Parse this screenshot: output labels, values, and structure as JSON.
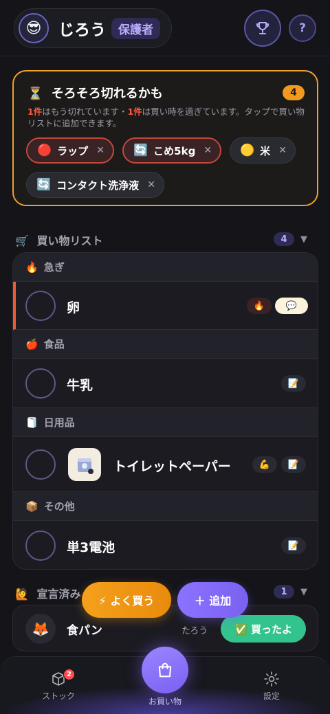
{
  "header": {
    "avatar_emoji": "😎",
    "user_name": "じろう",
    "role": "保護者",
    "help_label": "?"
  },
  "alert": {
    "icon": "⏳",
    "title": "そろそろ切れるかも",
    "count": "4",
    "desc_count1": "1件",
    "desc_part1": "はもう切れています・",
    "desc_count2": "1件",
    "desc_part2": "は買い時を過ぎています。タップで買い物リストに追加できます。",
    "chips": [
      {
        "emoji": "🔴",
        "label": "ラップ",
        "close": "✕",
        "style": "red"
      },
      {
        "emoji": "🔄",
        "label": "こめ5kg",
        "close": "✕",
        "style": "red"
      },
      {
        "emoji": "🟡",
        "label": "米",
        "close": "✕",
        "style": "gray"
      },
      {
        "emoji": "🔄",
        "label": "コンタクト洗浄液",
        "close": "✕",
        "style": "gray"
      }
    ]
  },
  "shopping_list": {
    "icon": "🛒",
    "title": "買い物リスト",
    "count": "4",
    "chevron": "▼",
    "groups": [
      {
        "emoji": "🔥",
        "label": "急ぎ"
      },
      {
        "emoji": "🍎",
        "label": "食品"
      },
      {
        "emoji": "🧻",
        "label": "日用品"
      },
      {
        "emoji": "📦",
        "label": "その他"
      }
    ],
    "items": [
      {
        "name": "卵",
        "tags": [
          "🔥",
          "💬"
        ]
      },
      {
        "name": "牛乳",
        "tags": [
          "📝"
        ]
      },
      {
        "name": "トイレットペーパー",
        "tags": [
          "💪",
          "📝"
        ]
      },
      {
        "name": "単3電池",
        "tags": [
          "📝"
        ]
      }
    ]
  },
  "declared": {
    "icon": "🙋",
    "title": "宣言済み",
    "count": "1",
    "chevron": "▼",
    "avatar_emoji": "🦊",
    "item": "食パン",
    "by": "たろう",
    "button": "✅ 買ったよ"
  },
  "fab": {
    "frequent": "⚡ よく買う",
    "add": "＋ 追加"
  },
  "nav": {
    "stock_label": "ストック",
    "stock_badge": "2",
    "shopping_label": "お買い物",
    "settings_label": "設定"
  },
  "colors": {
    "accent": "#7a61f0",
    "warning": "#f0a12f",
    "danger": "#ef5a32",
    "success": "#33c48e"
  }
}
